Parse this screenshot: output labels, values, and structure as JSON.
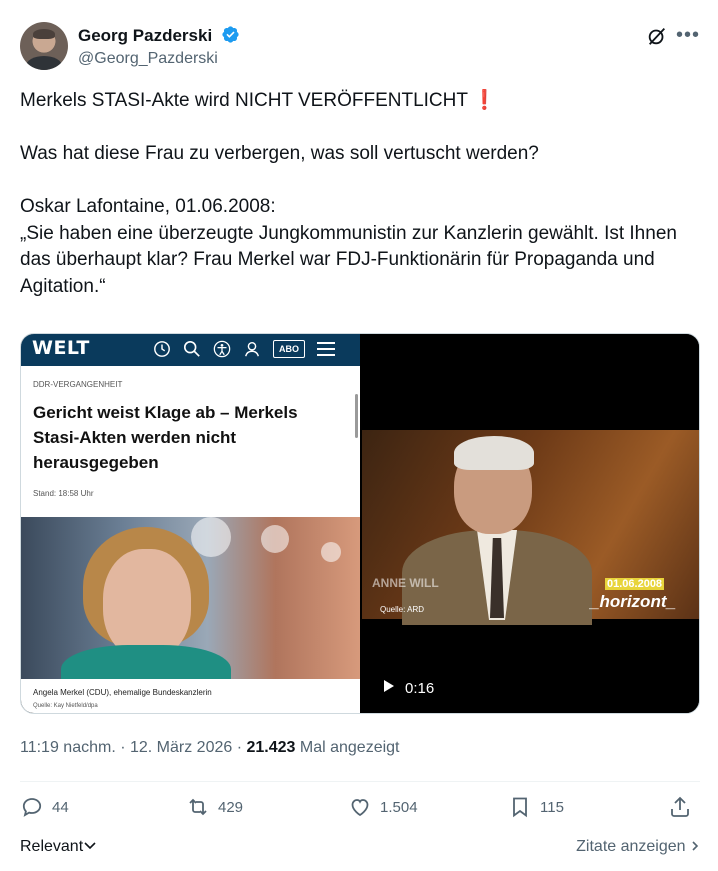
{
  "author": {
    "name": "Georg Pazderski",
    "handle": "@Georg_Pazderski"
  },
  "icons": {
    "verified": "verified-badge-icon",
    "grok": "grok-icon",
    "more": "more-icon"
  },
  "tweet": {
    "line1": "Merkels STASI-Akte wird NICHT VERÖFFENTLICHT",
    "emoji": "❗",
    "body": "Was hat diese Frau zu verbergen, was soll vertuscht werden?\n\nOskar Lafontaine, 01.06.2008:\n„Sie haben eine überzeugte Jungkommunistin zur Kanzlerin gewählt. Ist Ihnen das überhaupt klar? Frau Merkel war FDJ-Funktionärin für Propaganda und Agitation.“"
  },
  "media": {
    "welt": {
      "logo": "WELT",
      "abo": "ABO",
      "kicker": "DDR-VERGANGENHEIT",
      "headline": "Gericht weist Klage ab – Merkels Stasi-Akten werden nicht herausgegeben",
      "stand": "Stand: 18:58 Uhr",
      "caption": "Angela Merkel (CDU), ehemalige Bundeskanzlerin",
      "credit": "Quelle: Kay Nietfeld/dpa"
    },
    "video": {
      "anne_will": "ANNE WILL",
      "quelle": "Quelle: ARD",
      "date_tag": "01.06.2008",
      "channel": "_horizont_",
      "duration": "0:16"
    }
  },
  "meta": {
    "time": "11:19 nachm.",
    "date": "12. März 2026",
    "views": "21.423",
    "views_label": "Mal angezeigt"
  },
  "actions": {
    "replies": "44",
    "reposts": "429",
    "likes": "1.504",
    "bookmarks": "115"
  },
  "footer": {
    "sort_label": "Relevant",
    "quotes_label": "Zitate anzeigen"
  },
  "colors": {
    "verified": "#1d9bf0",
    "welt_bar": "#0a3a5c",
    "secondary_text": "#536471"
  }
}
